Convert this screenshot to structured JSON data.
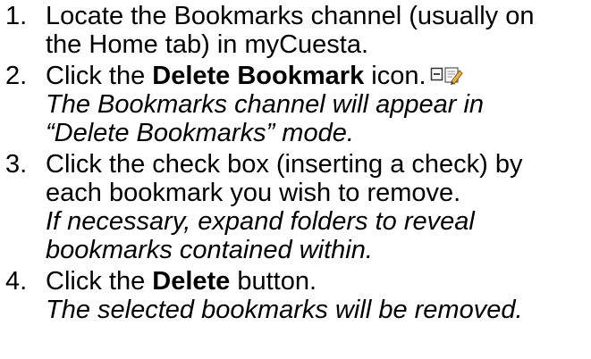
{
  "steps": [
    {
      "number": "1.",
      "line1": "Locate the Bookmarks channel (usually on",
      "line2": "the Home tab) in myCuesta."
    },
    {
      "number": "2.",
      "pre": "Click the ",
      "bold": "Delete Bookmark",
      "post": " icon.",
      "icon": "delete-bookmark-icon",
      "note_line1": "The Bookmarks channel will appear in",
      "note_line2": "“Delete Bookmarks” mode."
    },
    {
      "number": "3.",
      "line1": "Click the check box (inserting a check) by",
      "line2": "each bookmark you wish to remove.",
      "note_line1": "If necessary, expand folders to reveal",
      "note_line2": "bookmarks contained within."
    },
    {
      "number": "4.",
      "pre": "Click the ",
      "bold": "Delete",
      "post": " button.",
      "note_line1": "The selected bookmarks will be removed."
    }
  ]
}
